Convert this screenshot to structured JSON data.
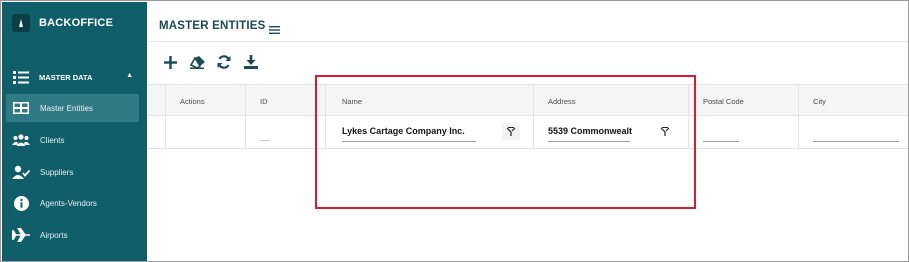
{
  "app": {
    "brand": "BACKOFFICE"
  },
  "sidebar": {
    "section_label": "MASTER DATA",
    "items": [
      {
        "label": "Master Entities",
        "icon": "table-icon",
        "active": true
      },
      {
        "label": "Clients",
        "icon": "users-icon"
      },
      {
        "label": "Suppliers",
        "icon": "user-check-icon"
      },
      {
        "label": "Agents-Vendors",
        "icon": "info-icon"
      },
      {
        "label": "Airports",
        "icon": "airplane-icon"
      }
    ]
  },
  "header": {
    "title": "MASTER ENTITIES"
  },
  "toolbar": {
    "buttons": [
      {
        "icon": "add-icon"
      },
      {
        "icon": "eraser-icon"
      },
      {
        "icon": "refresh-icon"
      },
      {
        "icon": "download-icon"
      }
    ]
  },
  "grid": {
    "columns": [
      "Actions",
      "ID",
      "Name",
      "Address",
      "Postal Code",
      "City"
    ],
    "filters": {
      "name": "Lykes Cartage Company Inc.",
      "address": "5539 Commonwealt"
    }
  },
  "colors": {
    "sidebar": "#0f5e6a",
    "sidebar_active": "#2f7a85",
    "highlight": "#d81e2d",
    "title": "#1c4a55"
  }
}
